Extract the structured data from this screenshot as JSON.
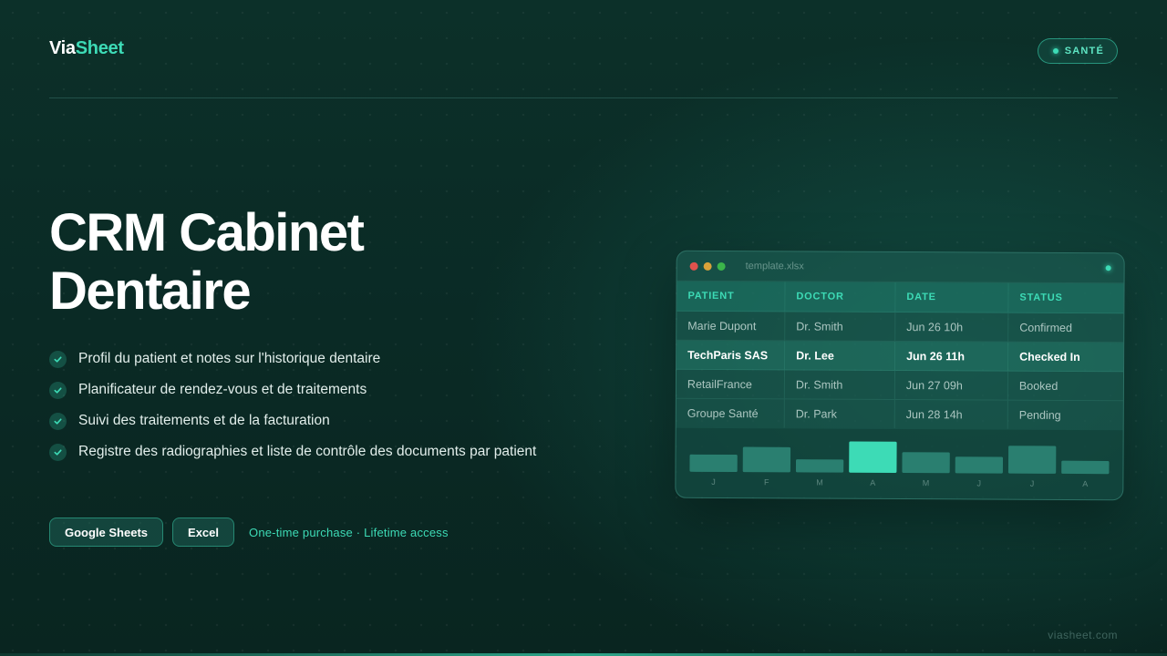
{
  "brand": {
    "part1": "Via",
    "part2": "Sheet"
  },
  "badge": {
    "label": "SANTÉ"
  },
  "hero": {
    "title_line1": "CRM Cabinet",
    "title_line2": "Dentaire"
  },
  "features": [
    "Profil du patient et notes sur l'historique dentaire",
    "Planificateur de rendez-vous et de traitements",
    "Suivi des traitements et de la facturation",
    "Registre des radiographies et liste de contrôle des documents par patient"
  ],
  "tags": {
    "google": "Google Sheets",
    "excel": "Excel"
  },
  "purchase_note": "One-time purchase · Lifetime access",
  "footer_url": "viasheet.com",
  "preview": {
    "file_name": "template.xlsx",
    "window_dots": [
      "#e0524d",
      "#d9a23a",
      "#3bb54a"
    ],
    "columns": [
      "PATIENT",
      "DOCTOR",
      "DATE",
      "STATUS"
    ],
    "rows": [
      [
        "Marie Dupont",
        "Dr. Smith",
        "Jun 26 10h",
        "Confirmed"
      ],
      [
        "TechParis SAS",
        "Dr. Lee",
        "Jun 26 11h",
        "Checked In"
      ],
      [
        "RetailFrance",
        "Dr. Smith",
        "Jun 27 09h",
        "Booked"
      ],
      [
        "Groupe Santé",
        "Dr. Park",
        "Jun 28 14h",
        "Pending"
      ]
    ],
    "highlighted_row": 1
  },
  "chart_data": {
    "type": "bar",
    "categories": [
      "J",
      "F",
      "M",
      "A",
      "M",
      "J",
      "J",
      "A"
    ],
    "values": [
      20,
      29,
      15,
      36,
      24,
      19,
      32,
      15
    ],
    "highlighted_index": 3,
    "ylim": [
      0,
      40
    ],
    "title": "",
    "xlabel": "",
    "ylabel": ""
  },
  "colors": {
    "accent": "#3ddbb6",
    "background": "#0b2c26",
    "bar": "#2a7f70",
    "bar_highlight": "#3ddbb6"
  }
}
